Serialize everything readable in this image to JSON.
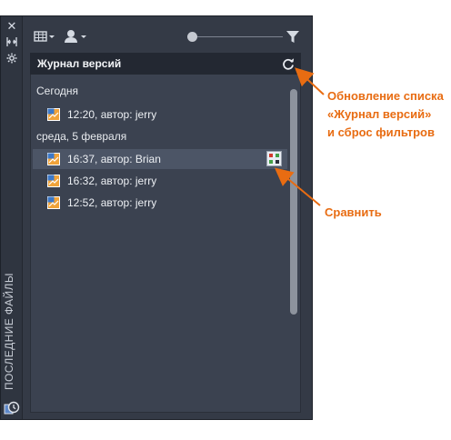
{
  "palette": {
    "side_title": "ПОСЛЕДНИЕ ФАЙЛЫ",
    "header_title": "Журнал версий",
    "groups": [
      {
        "label": "Сегодня",
        "items": [
          {
            "label": "12:20, автор: jerry",
            "selected": false
          }
        ]
      },
      {
        "label": "среда, 5 февраля",
        "items": [
          {
            "label": "16:37, автор: Brian",
            "selected": true
          },
          {
            "label": "16:32, автор: jerry",
            "selected": false
          },
          {
            "label": "12:52, автор: jerry",
            "selected": false
          }
        ]
      }
    ]
  },
  "callouts": {
    "refresh": [
      "Обновление списка",
      "«Журнал версий»",
      "и сброс фильтров"
    ],
    "compare": "Сравнить"
  },
  "colors": {
    "accent": "#e86c12",
    "panel": "#343a46",
    "list_bg": "#3b4250",
    "selected_row": "#4c5566"
  }
}
